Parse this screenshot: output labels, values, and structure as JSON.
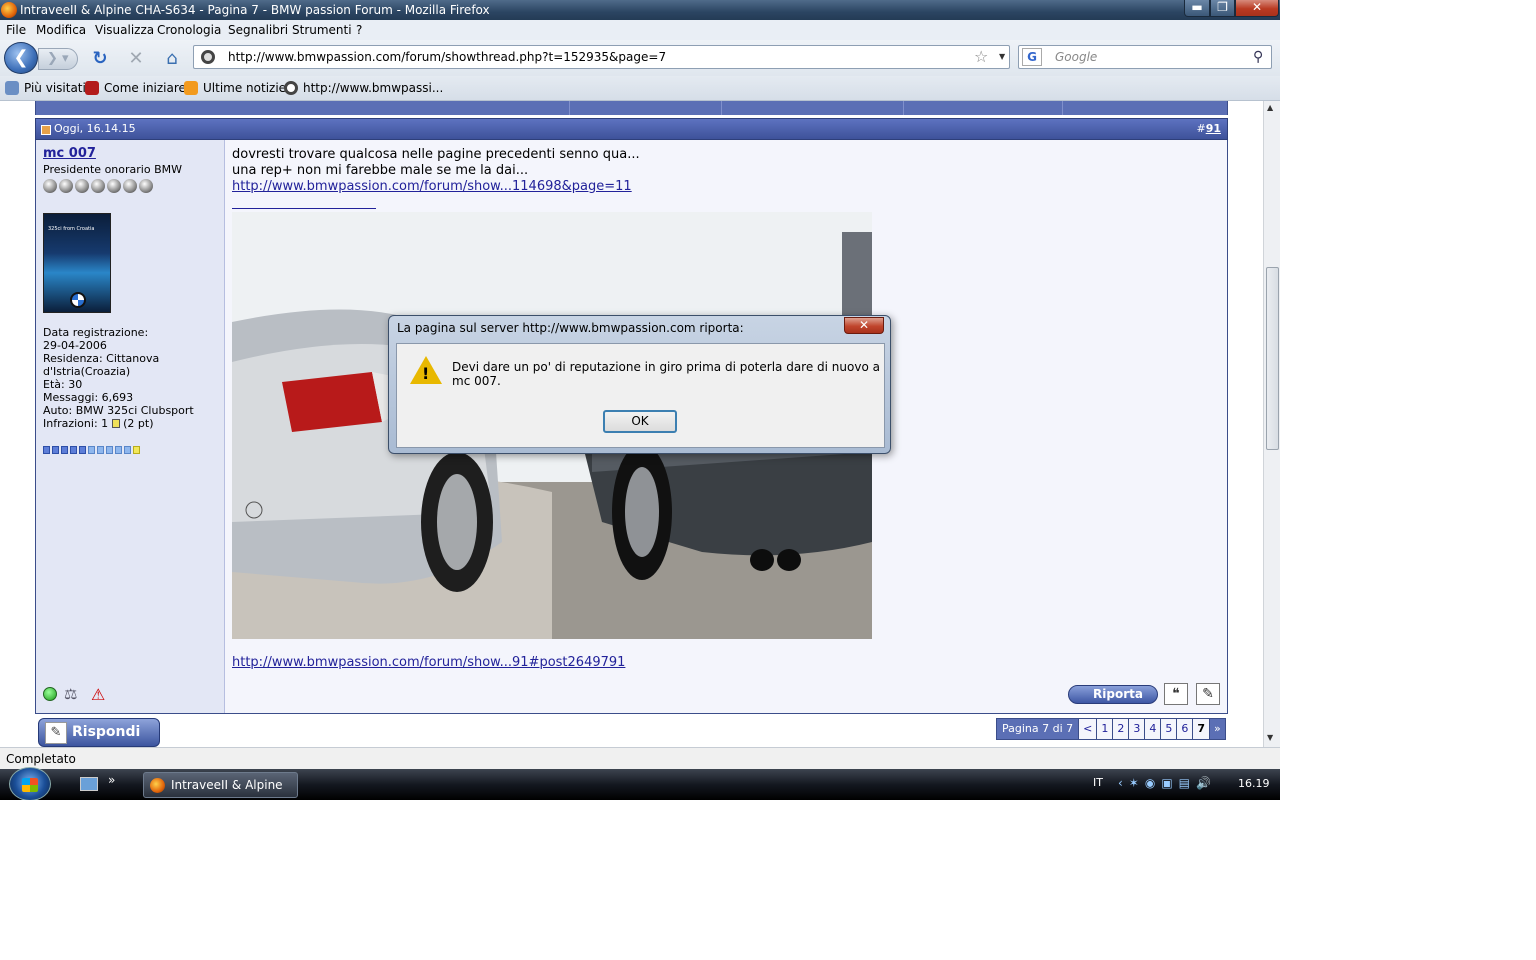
{
  "window": {
    "title": "IntraveeII & Alpine CHA-S634 - Pagina 7 - BMW passion Forum - Mozilla Firefox",
    "min": "▬",
    "max": "❐",
    "close": "✕"
  },
  "menu": [
    "File",
    "Modifica",
    "Visualizza",
    "Cronologia",
    "Segnalibri",
    "Strumenti",
    "?"
  ],
  "nav": {
    "url": "http://www.bmwpassion.com/forum/showthread.php?t=152935&page=7",
    "search_placeholder": "Google",
    "back_icon": "back-arrow-icon",
    "reload_icon": "reload-icon",
    "stop_icon": "stop-icon",
    "home_icon": "home-icon"
  },
  "bookmarks": [
    "Più visitati",
    "Come iniziare",
    "Ultime notizie",
    "http://www.bmwpassi..."
  ],
  "post": {
    "date": "Oggi, 16.14.15",
    "number_prefix": "#",
    "number": "91",
    "user": {
      "name": "mc 007",
      "title": "Presidente onorario BMW",
      "avatar_caption": "325ci from Croatia",
      "info": [
        "Data registrazione:",
        "29-04-2006",
        "Residenza: Cittanova",
        "d'Istria(Croazia)",
        "Età: 30",
        "Messaggi: 6,693",
        "Auto: BMW 325ci Clubsport"
      ],
      "infractions_label": "Infrazioni: 1",
      "infractions_points": "(2 pt)"
    },
    "lines": [
      "dovresti trovare qualcosa nelle pagine precedenti senno qua...",
      "una rep+ non mi farebbe male se me la dai..."
    ],
    "link1": "http://www.bmwpassion.com/forum/show...114698&page=11",
    "link2": "http://www.bmwpassion.com/forum/show...91#post2649791",
    "report_label": "Riporta"
  },
  "reply_label": "Rispondi",
  "pagenav": {
    "label": "Pagina 7 di 7",
    "prev": "<",
    "pages": [
      "1",
      "2",
      "3",
      "4",
      "5",
      "6"
    ],
    "current": "7",
    "last": "»"
  },
  "dialog": {
    "title": "La pagina sul server http://www.bmwpassion.com riporta:",
    "message": "Devi dare un po' di reputazione in giro prima di poterla dare di nuovo a mc 007.",
    "ok": "OK",
    "close": "✕"
  },
  "status": "Completato",
  "taskbar": {
    "task": "IntraveeII & Alpine ...",
    "lang": "IT",
    "clock": "16.19",
    "more": "»"
  }
}
